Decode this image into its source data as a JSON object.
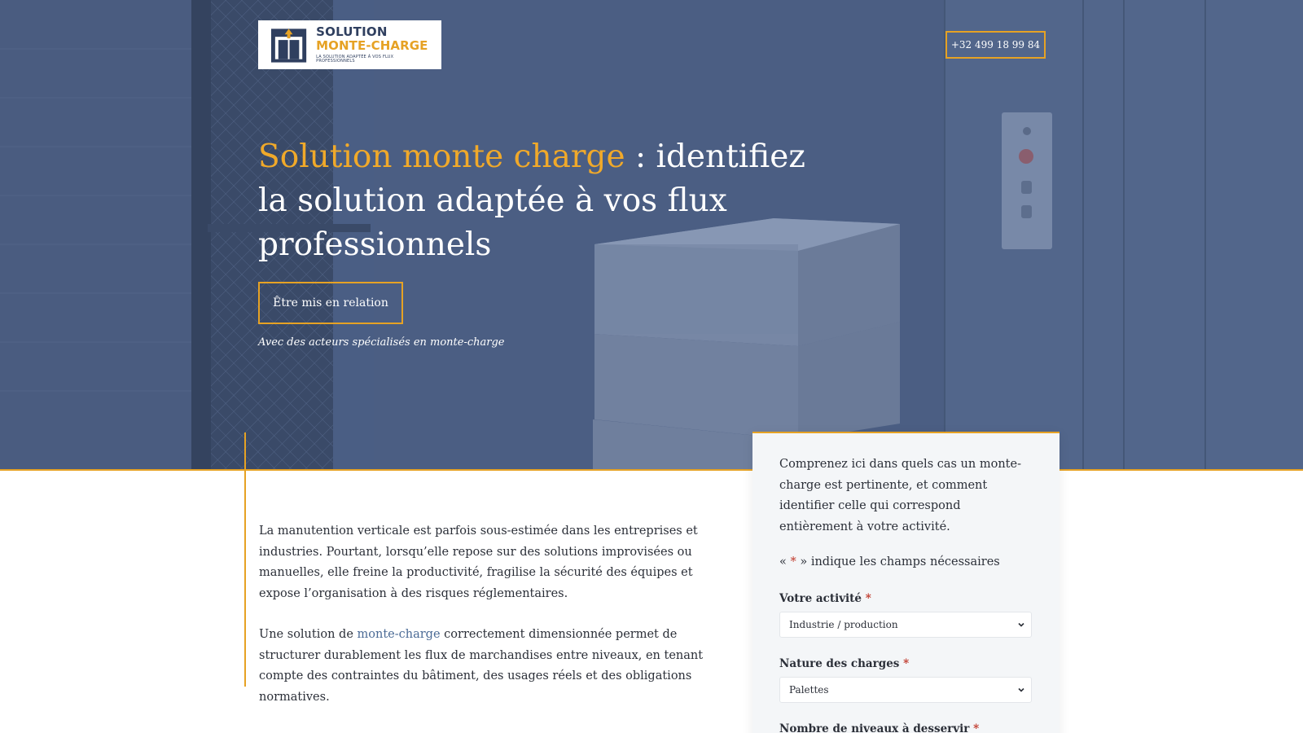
{
  "header": {
    "logo": {
      "line1": "SOLUTION",
      "line2": "MONTE-CHARGE",
      "tagline": "LA SOLUTION ADAPTÉE À VOS FLUX PROFESSIONNELS"
    },
    "phone": "+32 499 18 99 84"
  },
  "hero": {
    "title_accent": "Solution monte charge",
    "title_rest": " : identifiez la solution adaptée à vos flux professionnels",
    "cta_label": "Être mis en relation",
    "note": "Avec des acteurs spécialisés en monte-charge"
  },
  "content": {
    "paragraph1": "La manutention verticale est parfois sous-estimée dans les entreprises et industries. Pourtant, lorsqu’elle repose sur des solutions improvisées ou manuelles, elle freine la productivité, fragilise la sécurité des équipes et expose l’organisation à des risques réglementaires.",
    "paragraph2_before": "Une solution de ",
    "paragraph2_link": "monte-charge",
    "paragraph2_after": " correctement dimensionnée permet de structurer durablement les flux de marchandises entre niveaux, en tenant compte des contraintes du bâtiment, des usages réels et des obligations normatives."
  },
  "form": {
    "intro": "Comprenez ici dans quels cas un monte-charge est pertinente, et comment identifier celle qui correspond entièrement à votre activité.",
    "required_prefix": "« ",
    "required_star": "*",
    "required_suffix": " » indique les champs nécessaires",
    "fields": [
      {
        "label": "Votre activité",
        "required_mark": "*",
        "value": "Industrie / production"
      },
      {
        "label": "Nature des charges",
        "required_mark": "*",
        "value": "Palettes"
      },
      {
        "label": "Nombre de niveaux à desservir",
        "required_mark": "*"
      }
    ]
  },
  "colors": {
    "accent": "#e6a224",
    "hero_overlay": "#44567a",
    "link": "#4a6a95",
    "required": "#c0392b"
  }
}
